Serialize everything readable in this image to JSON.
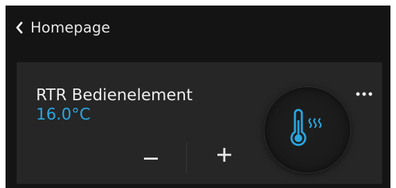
{
  "header": {
    "back_icon": "chevron-left-icon",
    "back_label": "Homepage"
  },
  "card": {
    "title": "RTR Bedienelement",
    "value": "16.0°C",
    "more_icon": "more-horizontal-icon",
    "minus_icon": "minus-icon",
    "plus_icon": "plus-icon",
    "dial_icon": "thermometer-heat-icon"
  },
  "colors": {
    "background": "#141414",
    "card": "#262626",
    "accent": "#29a5df",
    "text": "#eeeeee"
  }
}
